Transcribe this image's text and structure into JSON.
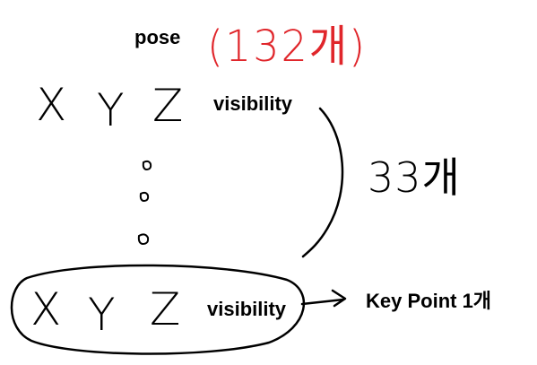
{
  "pose": {
    "label": "pose",
    "count": "(132개)",
    "count_color": "#e0262b"
  },
  "row_top": {
    "x": "X",
    "y": "Y",
    "z": "Z",
    "visibility": "visibility"
  },
  "row_bottom": {
    "x": "X",
    "y": "Y",
    "z": "Z",
    "visibility": "visibility"
  },
  "group_count": "33개",
  "keypoint_label": "Key Point 1개"
}
